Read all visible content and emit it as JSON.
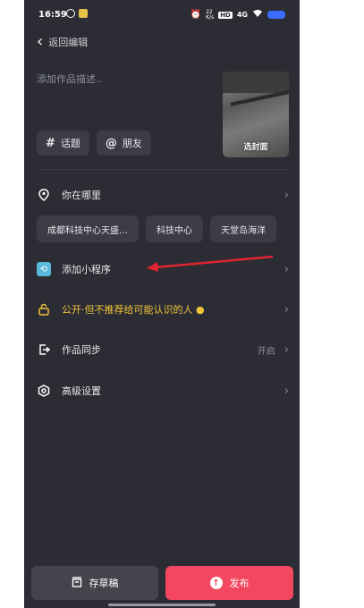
{
  "status_bar": {
    "time": "16:59",
    "network_speed_top": "22",
    "network_speed_bottom": "K/s",
    "hd_badge": "HD",
    "signal": "4G"
  },
  "back": {
    "label": "返回编辑"
  },
  "description": {
    "placeholder": "添加作品描述.."
  },
  "cover": {
    "label": "选封面"
  },
  "tags": [
    {
      "symbol": "#",
      "label": "话题"
    },
    {
      "symbol": "@",
      "label": "朋友"
    }
  ],
  "location": {
    "label": "你在哪里",
    "suggestions": [
      "成都科技中心天盛…",
      "科技中心",
      "天堂岛海洋"
    ]
  },
  "mini_program": {
    "label": "添加小程序"
  },
  "visibility": {
    "label": "公开·但不推荐给可能认识的人"
  },
  "sync": {
    "label": "作品同步",
    "value": "开启"
  },
  "advanced": {
    "label": "高级设置"
  },
  "bottom": {
    "draft": "存草稿",
    "publish": "发布"
  },
  "colors": {
    "accent": "#f2475f",
    "background": "#2b2c34",
    "arrow": "#e0242f",
    "warning": "#f3c43a"
  }
}
